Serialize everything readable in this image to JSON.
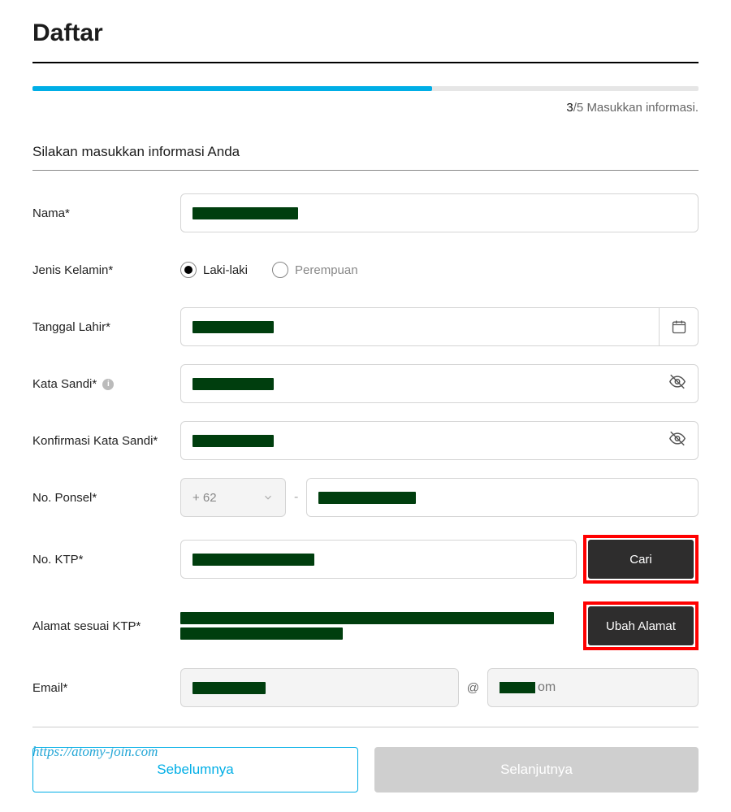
{
  "header": {
    "title": "Daftar"
  },
  "progress": {
    "percent": 60,
    "current": "3",
    "total": "/5",
    "label": "Masukkan informasi."
  },
  "section": {
    "title": "Silakan masukkan informasi Anda"
  },
  "labels": {
    "name": "Nama*",
    "gender": "Jenis Kelamin*",
    "dob": "Tanggal Lahir*",
    "password": "Kata Sandi*",
    "confirm": "Konfirmasi Kata Sandi*",
    "phone": "No. Ponsel*",
    "ktp": "No. KTP*",
    "address": "Alamat sesuai KTP*",
    "email": "Email*"
  },
  "gender": {
    "male": "Laki-laki",
    "female": "Perempuan",
    "selected": "male"
  },
  "phone": {
    "dialcode": "+ 62"
  },
  "buttons": {
    "search": "Cari",
    "change_address": "Ubah Alamat",
    "prev": "Sebelumnya",
    "next": "Selanjutnya"
  },
  "email": {
    "at": "@",
    "domain_suffix": "om"
  },
  "watermark": "https://atomy-join.com"
}
